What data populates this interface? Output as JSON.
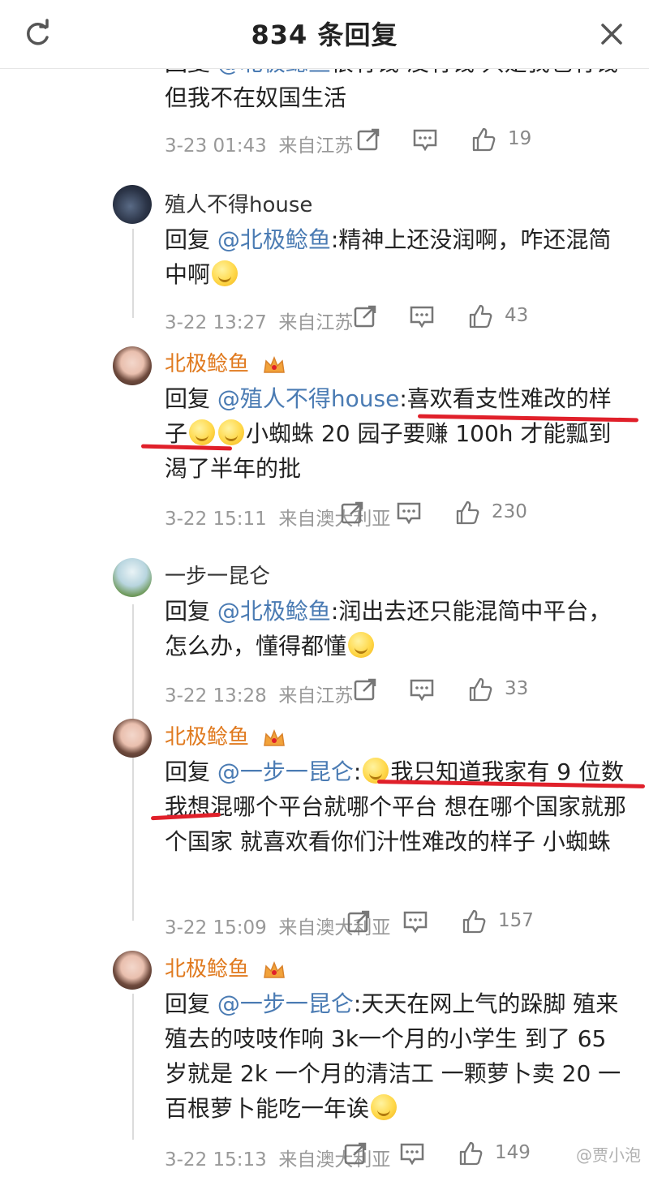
{
  "header": {
    "title": "834 条回复",
    "refresh_icon": "refresh-icon",
    "close_icon": "close-icon"
  },
  "comments": [
    {
      "user": "",
      "text_pre": "回复 ",
      "mention": "@北极鲶鱼",
      "text_post": "很有钱 没有钱 只是我也有钱 但我不在奴国生活",
      "time": "3-23 01:43",
      "location": "来自江苏",
      "likes": "19"
    },
    {
      "user": "殖人不得house",
      "text_pre": "回复 ",
      "mention": "@北极鲶鱼",
      "text_post": ":精神上还没润啊，咋还混简中啊",
      "time": "3-22 13:27",
      "location": "来自江苏",
      "likes": "43"
    },
    {
      "user": "北极鲶鱼",
      "text_pre": "回复 ",
      "mention": "@殖人不得house",
      "text_post": ":喜欢看支性难改的样子",
      "text_post2": "小蜘蛛 20 园子要赚 100h 才能瓢到渴了半年的批",
      "time": "3-22 15:11",
      "location": "来自澳大利亚",
      "likes": "230"
    },
    {
      "user": "一步一昆仑",
      "text_pre": "回复 ",
      "mention": "@北极鲶鱼",
      "text_post": ":润出去还只能混简中平台，怎么办，懂得都懂",
      "time": "3-22 13:28",
      "location": "来自江苏",
      "likes": "33"
    },
    {
      "user": "北极鲶鱼",
      "text_pre": "回复 ",
      "mention": "@一步一昆仑",
      "text_post": "我只知道我家有 9 位数 我想混哪个平台就哪个平台 想在哪个国家就那个国家 就喜欢看你们汁性难改的样子 小蜘蛛",
      "time": "3-22 15:09",
      "location": "来自澳大利亚",
      "likes": "157"
    },
    {
      "user": "北极鲶鱼",
      "text_pre": "回复 ",
      "mention": "@一步一昆仑",
      "text_post": ":天天在网上气的跺脚 殖来殖去的吱吱作响 3k一个月的小学生 到了 65 岁就是 2k 一个月的清洁工 一颗萝卜卖 20 一百根萝卜能吃一年诶",
      "time": "3-22 15:13",
      "location": "来自澳大利亚",
      "likes": "149"
    }
  ],
  "watermark": "@贾小泡",
  "colors": {
    "mention": "#4a7bb3",
    "vip_username": "#e07a1f",
    "underline": "#e0202a",
    "meta": "#999999"
  }
}
